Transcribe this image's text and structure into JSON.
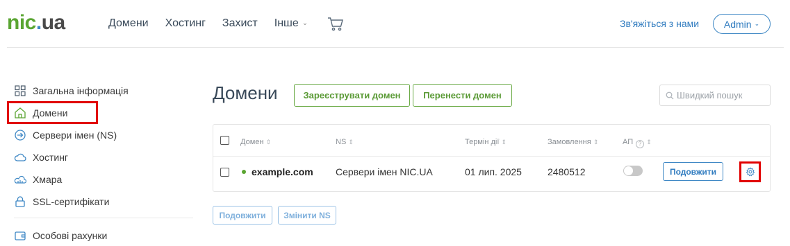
{
  "header": {
    "logo": {
      "part1": "nic",
      "part2": ".",
      "part3": "ua"
    },
    "nav": [
      {
        "label": "Домени"
      },
      {
        "label": "Хостинг"
      },
      {
        "label": "Захист"
      },
      {
        "label": "Інше"
      }
    ],
    "contact_label": "Зв'яжіться з нами",
    "account_label": "Admin"
  },
  "sidebar": {
    "items": [
      {
        "label": "Загальна інформація",
        "icon": "grid-icon"
      },
      {
        "label": "Домени",
        "icon": "house-icon"
      },
      {
        "label": "Сервери імен (NS)",
        "icon": "arrow-circle-icon"
      },
      {
        "label": "Хостинг",
        "icon": "cloud-icon"
      },
      {
        "label": "Хмара",
        "icon": "cloud-stack-icon"
      },
      {
        "label": "SSL-сертифікати",
        "icon": "lock-icon"
      },
      {
        "label": "Особові рахунки",
        "icon": "wallet-icon"
      }
    ]
  },
  "main": {
    "title": "Домени",
    "register_label": "Зареєструвати домен",
    "transfer_label": "Перенести домен",
    "search_placeholder": "Швидкий пошук",
    "table": {
      "headers": {
        "domain": "Домен",
        "ns": "NS",
        "term": "Термін дії",
        "order": "Замовлення",
        "autorenew": "АП"
      },
      "rows": [
        {
          "domain": "example.com",
          "ns": "Сервери імен NIC.UA",
          "term": "01 лип. 2025",
          "order": "2480512",
          "autorenew": false,
          "renew_label": "Подовжити"
        }
      ]
    },
    "bulk": {
      "renew_label": "Подовжити",
      "change_ns_label": "Змінити NS"
    }
  },
  "colors": {
    "brand_green": "#5aa532",
    "brand_blue": "#3f88c5",
    "highlight_red": "#e10000"
  }
}
